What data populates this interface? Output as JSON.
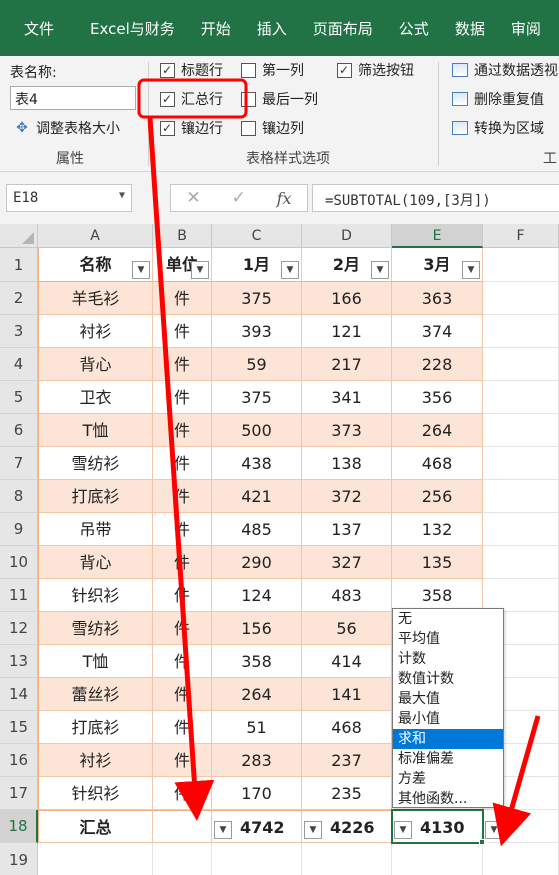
{
  "ribbon_tabs": [
    "文件",
    "Excel与财务",
    "开始",
    "插入",
    "页面布局",
    "公式",
    "数据",
    "审阅"
  ],
  "properties_group": {
    "table_name_label": "表名称:",
    "table_name_value": "表4",
    "resize_label": "调整表格大小",
    "group_label": "属性"
  },
  "style_options": {
    "header_row": "标题行",
    "total_row": "汇总行",
    "banded_rows": "镶边行",
    "first_column": "第一列",
    "last_column": "最后一列",
    "banded_columns": "镶边列",
    "filter_button": "筛选按钮",
    "group_label": "表格样式选项"
  },
  "tools_group": {
    "pivot": "通过数据透视",
    "remove_duplicates": "删除重复值",
    "convert_range": "转换为区域",
    "group_label": "工"
  },
  "formula_bar": {
    "name_box": "E18",
    "cancel": "✕",
    "confirm": "✓",
    "fx": "fx",
    "formula": "=SUBTOTAL(109,[3月])"
  },
  "columns": [
    "A",
    "B",
    "C",
    "D",
    "E",
    "F"
  ],
  "row_numbers": [
    "1",
    "2",
    "3",
    "4",
    "5",
    "6",
    "7",
    "8",
    "9",
    "10",
    "11",
    "12",
    "13",
    "14",
    "15",
    "16",
    "17",
    "18",
    "19"
  ],
  "table": {
    "headers": [
      "名称",
      "单位",
      "1月",
      "2月",
      "3月"
    ],
    "rows": [
      [
        "羊毛衫",
        "件",
        "375",
        "166",
        "363"
      ],
      [
        "衬衫",
        "件",
        "393",
        "121",
        "374"
      ],
      [
        "背心",
        "件",
        "59",
        "217",
        "228"
      ],
      [
        "卫衣",
        "件",
        "375",
        "341",
        "356"
      ],
      [
        "T恤",
        "件",
        "500",
        "373",
        "264"
      ],
      [
        "雪纺衫",
        "件",
        "438",
        "138",
        "468"
      ],
      [
        "打底衫",
        "件",
        "421",
        "372",
        "256"
      ],
      [
        "吊带",
        "件",
        "485",
        "137",
        "132"
      ],
      [
        "背心",
        "件",
        "290",
        "327",
        "135"
      ],
      [
        "针织衫",
        "件",
        "124",
        "483",
        "358"
      ],
      [
        "雪纺衫",
        "件",
        "156",
        "56",
        ""
      ],
      [
        "T恤",
        "件",
        "358",
        "414",
        ""
      ],
      [
        "蕾丝衫",
        "件",
        "264",
        "141",
        ""
      ],
      [
        "打底衫",
        "件",
        "51",
        "468",
        ""
      ],
      [
        "衬衫",
        "件",
        "283",
        "237",
        ""
      ],
      [
        "针织衫",
        "件",
        "170",
        "235",
        ""
      ]
    ],
    "totals": [
      "汇总",
      "",
      "4742",
      "4226",
      "4130"
    ]
  },
  "dropdown_options": [
    "无",
    "平均值",
    "计数",
    "数值计数",
    "最大值",
    "最小值",
    "求和",
    "标准偏差",
    "方差",
    "其他函数..."
  ],
  "dropdown_selected": "求和",
  "colors": {
    "ribbon_green": "#217346",
    "band_fill": "#fce4d6",
    "annotation_red": "#ff0000",
    "selected_option": "#0078d7"
  }
}
